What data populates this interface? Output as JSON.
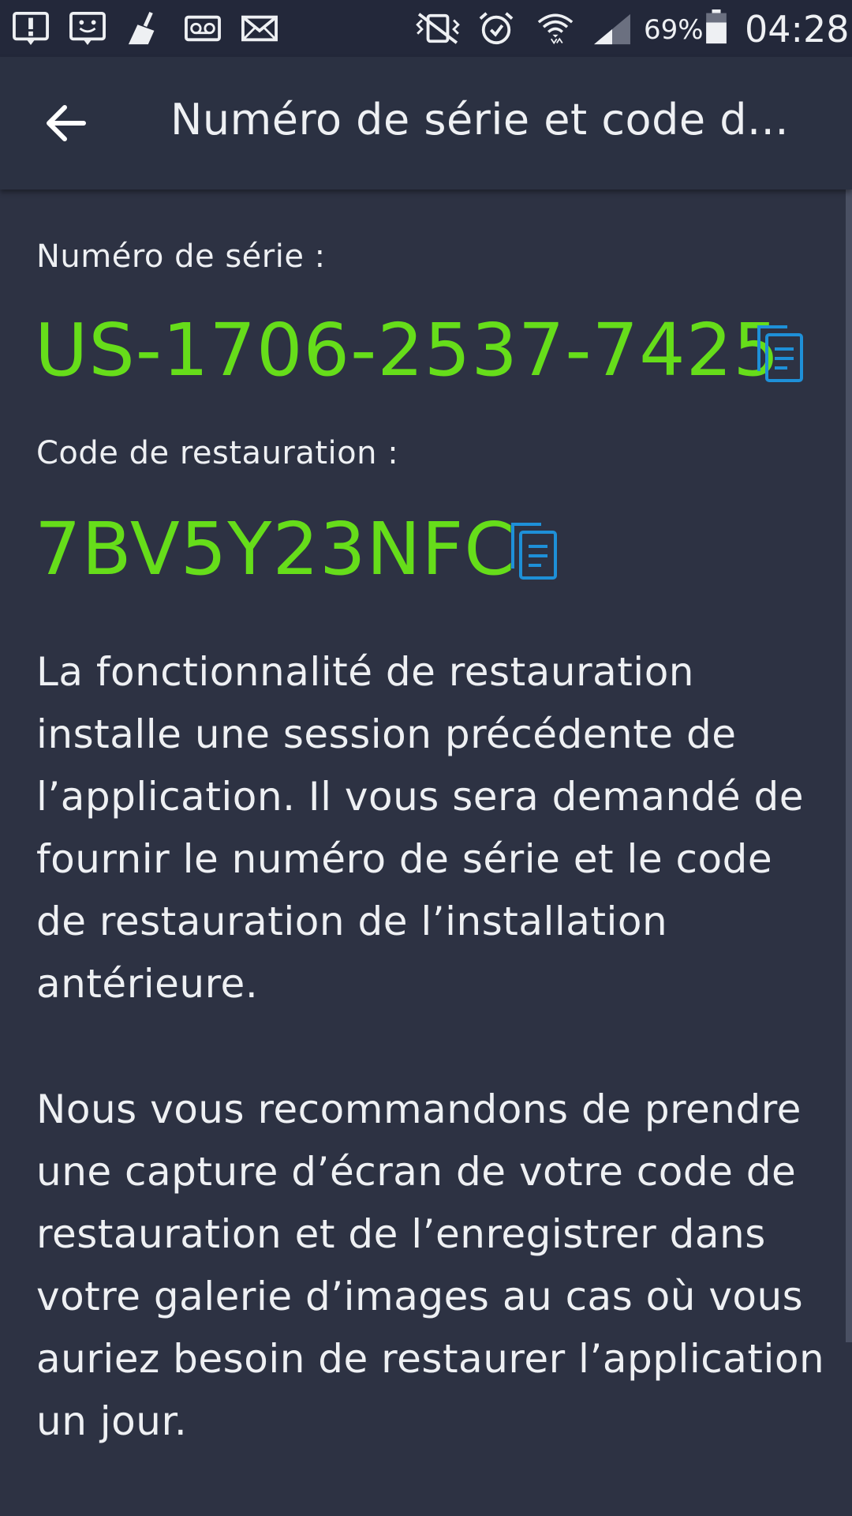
{
  "status_bar": {
    "battery_percent": "69%",
    "time": "04:28",
    "icons": [
      "alert-icon",
      "face-notification-icon",
      "cleaner-icon",
      "voicemail-icon",
      "email-icon",
      "vibrate-mute-icon",
      "alarm-icon",
      "wifi-icon",
      "signal-icon",
      "battery-icon"
    ]
  },
  "app_bar": {
    "back_icon": "arrow-left-icon",
    "title": "Numéro de série et code d..."
  },
  "serial": {
    "label": "Numéro de série :",
    "value": "US-1706-2537-7425",
    "copy_icon": "copy-icon"
  },
  "restore": {
    "label": "Code de restauration :",
    "value": "7BV5Y23NFC",
    "copy_icon": "copy-icon"
  },
  "paragraphs": {
    "p1": "La fonctionnalité de restauration installe une session précédente de l’application. Il vous sera demandé de fournir le numéro de série et le code de restauration de l’installation antérieure.",
    "p2": "Nous vous recommandons de prendre une capture d’écran de votre code de restauration et de l’enregistrer dans votre galerie d’images au cas où vous auriez besoin de restaurer l’application un jour."
  },
  "colors": {
    "background": "#2d3243",
    "status_bar": "#23283a",
    "app_bar": "#2b3142",
    "code_green": "#66dd1a",
    "copy_blue": "#1e90d8",
    "text": "#eef0f3"
  }
}
